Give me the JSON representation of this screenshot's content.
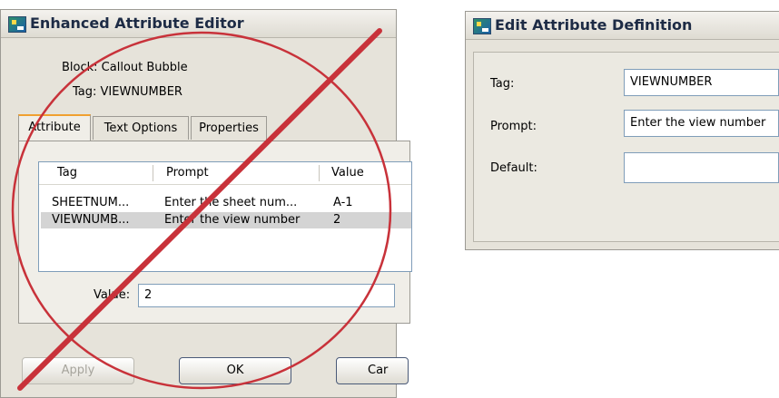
{
  "left_dialog": {
    "title": "Enhanced Attribute Editor",
    "block_line": "Block: Callout Bubble",
    "tag_line": "Tag: VIEWNUMBER",
    "tabs": [
      {
        "label": "Attribute",
        "active": true
      },
      {
        "label": "Text Options",
        "active": false
      },
      {
        "label": "Properties",
        "active": false
      }
    ],
    "table": {
      "columns": [
        "Tag",
        "Prompt",
        "Value"
      ],
      "rows": [
        {
          "tag": "SHEETNUM...",
          "prompt": "Enter the sheet num...",
          "value": "A-1",
          "selected": false
        },
        {
          "tag": "VIEWNUMB...",
          "prompt": "Enter the view number",
          "value": "2",
          "selected": true
        }
      ]
    },
    "value_label": "Value:",
    "value_field": "2",
    "buttons": {
      "apply": "Apply",
      "ok": "OK",
      "cancel": "Car"
    }
  },
  "right_dialog": {
    "title": "Edit Attribute Definition",
    "tag_label": "Tag:",
    "tag_value": "VIEWNUMBER",
    "prompt_label": "Prompt:",
    "prompt_value": "Enter the view number",
    "default_label": "Default:",
    "default_value": ""
  },
  "overlay": {
    "type": "prohibition-sign",
    "color": "#c8323a"
  }
}
